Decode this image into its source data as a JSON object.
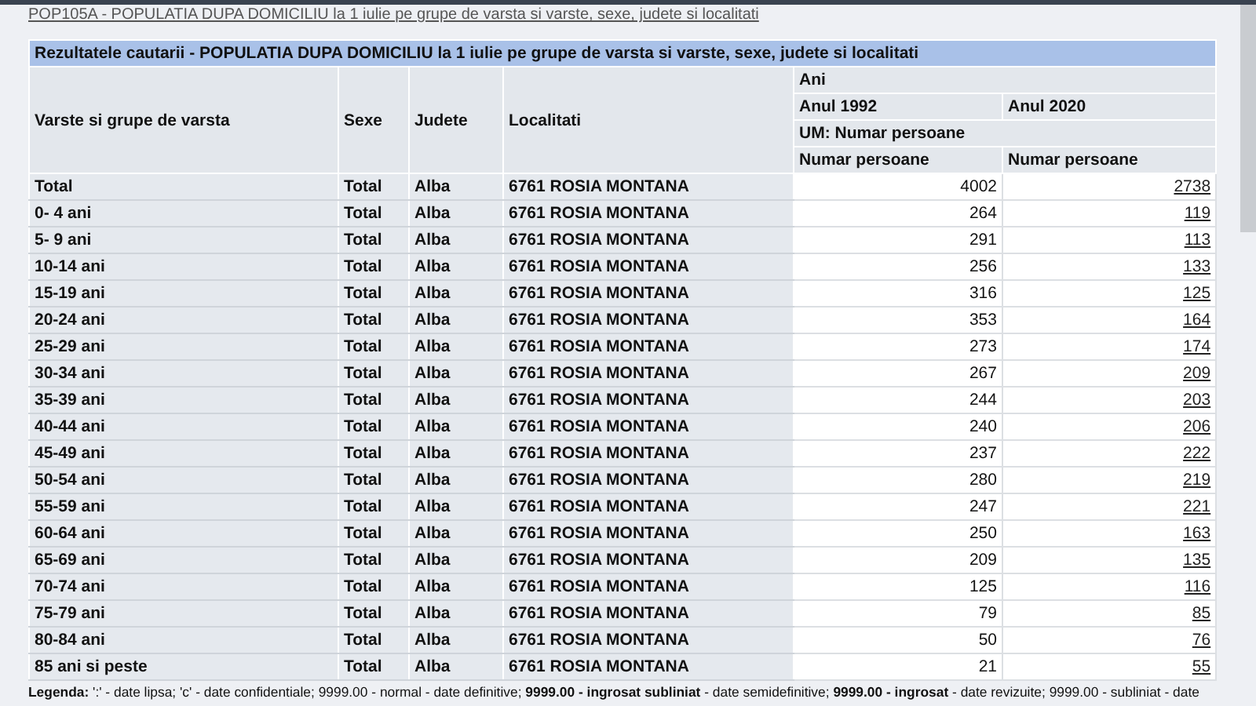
{
  "breadcrumb_link": "POP105A - POPULATIA DUPA DOMICILIU la 1 iulie pe grupe de varsta si varste, sexe, judete si localitati",
  "table": {
    "title": "Rezultatele cautarii - POPULATIA DUPA DOMICILIU la 1 iulie pe grupe de varsta si varste, sexe, judete si localitati",
    "columns": [
      "Varste si grupe de varsta",
      "Sexe",
      "Judete",
      "Localitati"
    ],
    "group_header": "Ani",
    "years": [
      "Anul 1992",
      "Anul 2020"
    ],
    "unit": "UM: Numar persoane",
    "value_headers": [
      "Numar persoane",
      "Numar persoane"
    ],
    "rows": [
      {
        "age": "Total",
        "sex": "Total",
        "county": "Alba",
        "locality": "6761 ROSIA MONTANA",
        "v1992": "4002",
        "v2020": "2738"
      },
      {
        "age": "0- 4 ani",
        "sex": "Total",
        "county": "Alba",
        "locality": "6761 ROSIA MONTANA",
        "v1992": "264",
        "v2020": "119"
      },
      {
        "age": "5- 9 ani",
        "sex": "Total",
        "county": "Alba",
        "locality": "6761 ROSIA MONTANA",
        "v1992": "291",
        "v2020": "113"
      },
      {
        "age": "10-14 ani",
        "sex": "Total",
        "county": "Alba",
        "locality": "6761 ROSIA MONTANA",
        "v1992": "256",
        "v2020": "133"
      },
      {
        "age": "15-19 ani",
        "sex": "Total",
        "county": "Alba",
        "locality": "6761 ROSIA MONTANA",
        "v1992": "316",
        "v2020": "125"
      },
      {
        "age": "20-24 ani",
        "sex": "Total",
        "county": "Alba",
        "locality": "6761 ROSIA MONTANA",
        "v1992": "353",
        "v2020": "164"
      },
      {
        "age": "25-29 ani",
        "sex": "Total",
        "county": "Alba",
        "locality": "6761 ROSIA MONTANA",
        "v1992": "273",
        "v2020": "174"
      },
      {
        "age": "30-34 ani",
        "sex": "Total",
        "county": "Alba",
        "locality": "6761 ROSIA MONTANA",
        "v1992": "267",
        "v2020": "209"
      },
      {
        "age": "35-39 ani",
        "sex": "Total",
        "county": "Alba",
        "locality": "6761 ROSIA MONTANA",
        "v1992": "244",
        "v2020": "203"
      },
      {
        "age": "40-44 ani",
        "sex": "Total",
        "county": "Alba",
        "locality": "6761 ROSIA MONTANA",
        "v1992": "240",
        "v2020": "206"
      },
      {
        "age": "45-49 ani",
        "sex": "Total",
        "county": "Alba",
        "locality": "6761 ROSIA MONTANA",
        "v1992": "237",
        "v2020": "222"
      },
      {
        "age": "50-54 ani",
        "sex": "Total",
        "county": "Alba",
        "locality": "6761 ROSIA MONTANA",
        "v1992": "280",
        "v2020": "219"
      },
      {
        "age": "55-59 ani",
        "sex": "Total",
        "county": "Alba",
        "locality": "6761 ROSIA MONTANA",
        "v1992": "247",
        "v2020": "221"
      },
      {
        "age": "60-64 ani",
        "sex": "Total",
        "county": "Alba",
        "locality": "6761 ROSIA MONTANA",
        "v1992": "250",
        "v2020": "163"
      },
      {
        "age": "65-69 ani",
        "sex": "Total",
        "county": "Alba",
        "locality": "6761 ROSIA MONTANA",
        "v1992": "209",
        "v2020": "135"
      },
      {
        "age": "70-74 ani",
        "sex": "Total",
        "county": "Alba",
        "locality": "6761 ROSIA MONTANA",
        "v1992": "125",
        "v2020": "116"
      },
      {
        "age": "75-79 ani",
        "sex": "Total",
        "county": "Alba",
        "locality": "6761 ROSIA MONTANA",
        "v1992": "79",
        "v2020": "85"
      },
      {
        "age": "80-84 ani",
        "sex": "Total",
        "county": "Alba",
        "locality": "6761 ROSIA MONTANA",
        "v1992": "50",
        "v2020": "76"
      },
      {
        "age": "85 ani si peste",
        "sex": "Total",
        "county": "Alba",
        "locality": "6761 ROSIA MONTANA",
        "v1992": "21",
        "v2020": "55"
      }
    ]
  },
  "legend": "**Legenda:** ':' - date lipsa; 'c' - date confidentiale; 9999.00 - normal - date definitive; **9999.00 - ingrosat subliniat** - date semidefinitive; **9999.00 - ingrosat** - date revizuite; 9999.00 - subliniat - date"
}
